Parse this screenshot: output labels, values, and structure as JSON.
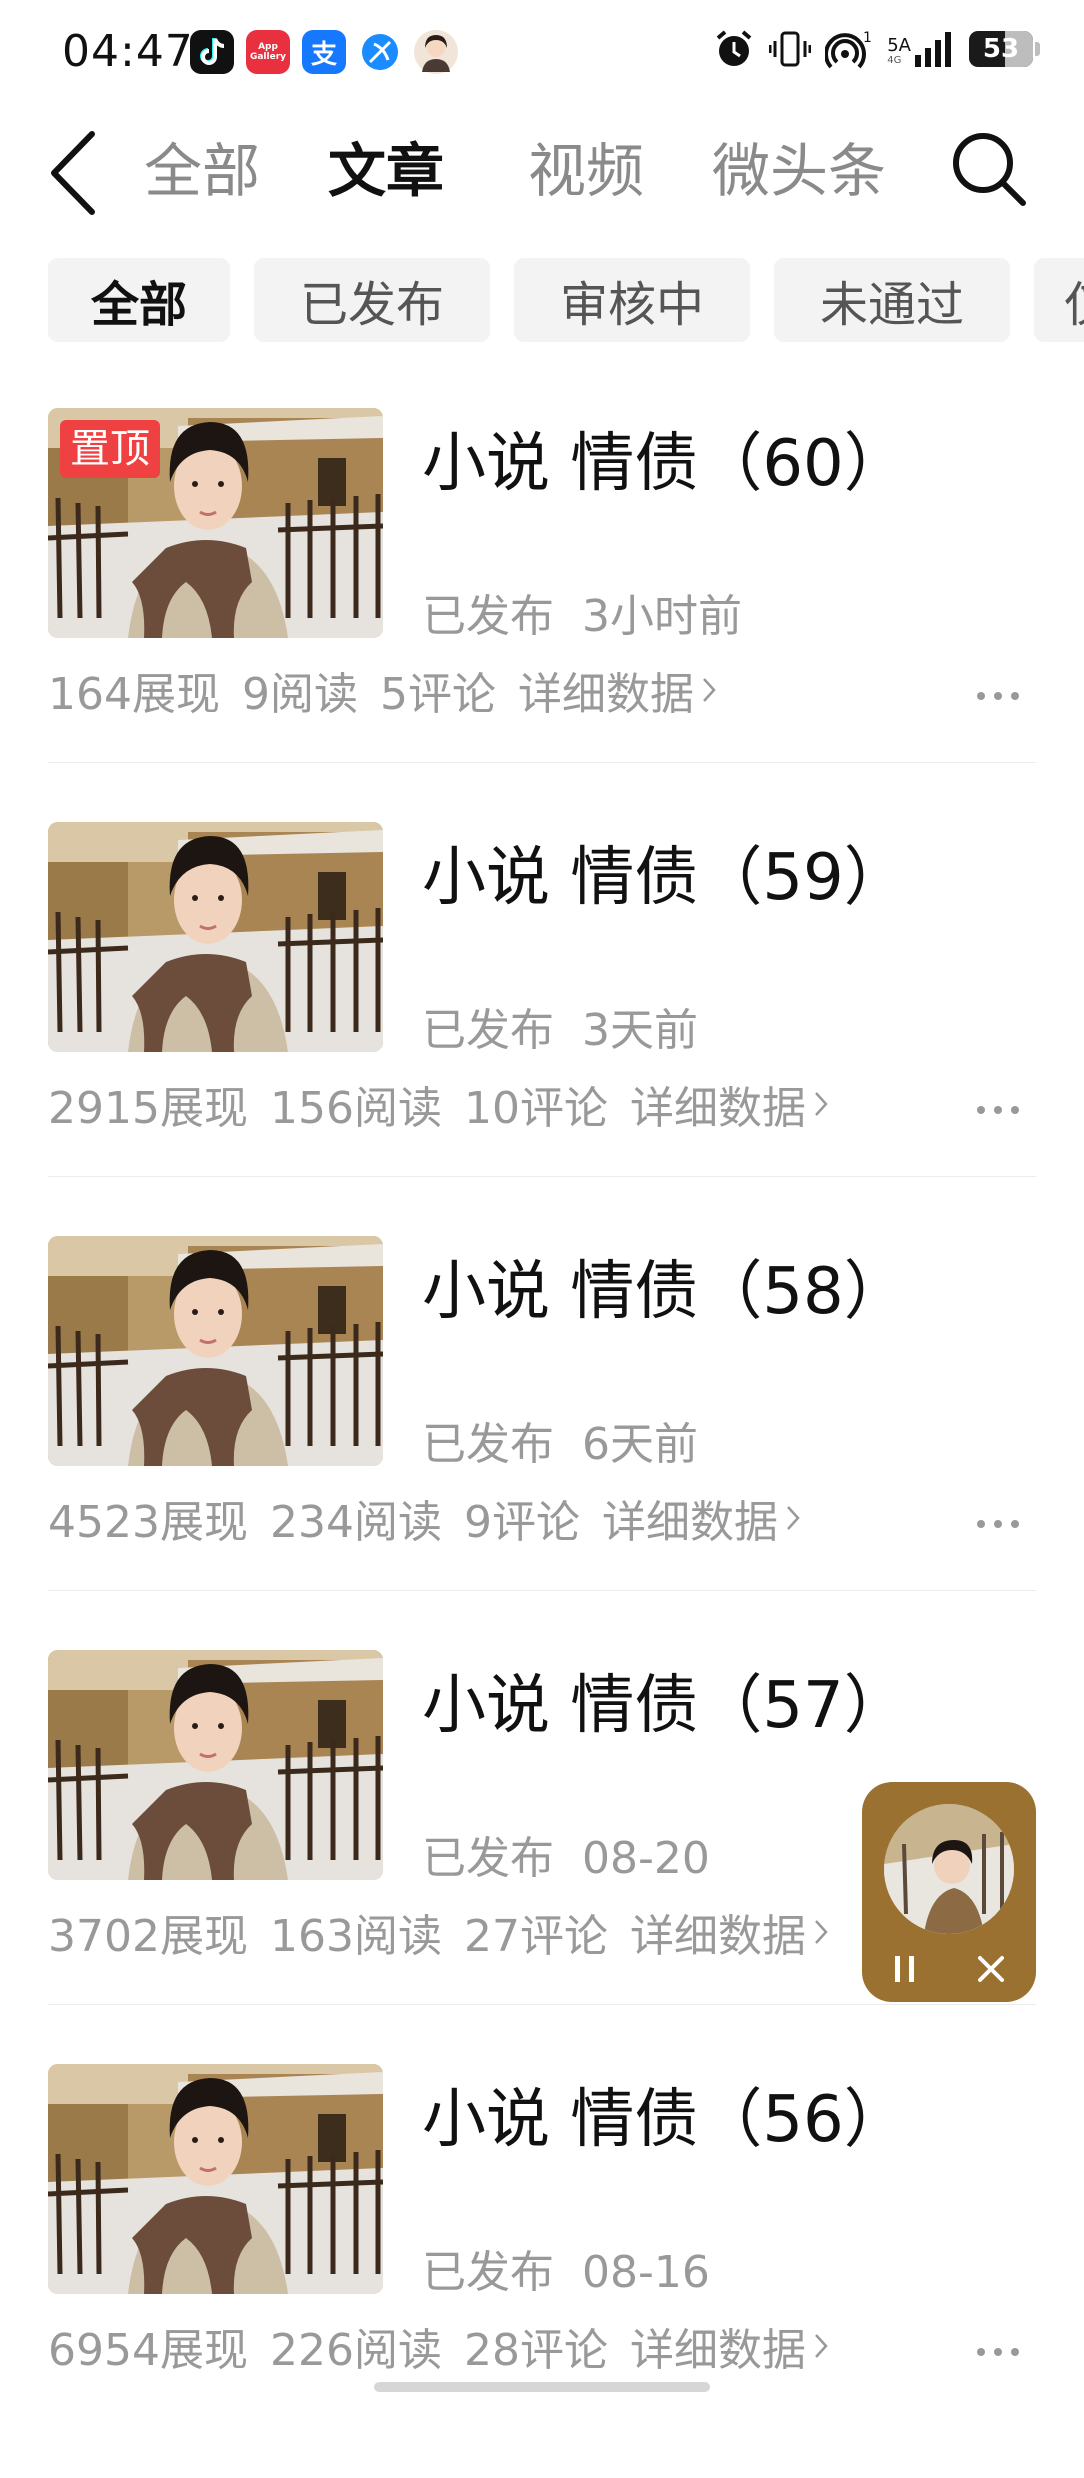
{
  "status_bar": {
    "time": "04:47",
    "apps": [
      "tiktok-icon",
      "app-gallery-icon",
      "alipay-icon",
      "browser-icon",
      "avatar-icon"
    ],
    "app_gallery_label": "App Gallery",
    "alipay_glyph": "支",
    "network_label": "5A",
    "hotspot_count": "1",
    "battery": "53"
  },
  "nav": {
    "tabs": [
      "全部",
      "文章",
      "视频",
      "微头条"
    ],
    "active_tab": "文章"
  },
  "filters": {
    "chips": [
      "全部",
      "已发布",
      "审核中",
      "未通过",
      "仅"
    ],
    "active": "全部"
  },
  "articles": [
    {
      "title": "小说 情债（60）",
      "pinned": true,
      "pin_label": "置顶",
      "status": "已发布",
      "time": "3小时前",
      "views": "164展现",
      "reads": "9阅读",
      "comments": "5评论",
      "detail": "详细数据"
    },
    {
      "title": "小说 情债（59）",
      "pinned": false,
      "status": "已发布",
      "time": "3天前",
      "views": "2915展现",
      "reads": "156阅读",
      "comments": "10评论",
      "detail": "详细数据"
    },
    {
      "title": "小说 情债（58）",
      "pinned": false,
      "status": "已发布",
      "time": "6天前",
      "views": "4523展现",
      "reads": "234阅读",
      "comments": "9评论",
      "detail": "详细数据"
    },
    {
      "title": "小说 情债（57）",
      "pinned": false,
      "status": "已发布",
      "time": "08-20",
      "views": "3702展现",
      "reads": "163阅读",
      "comments": "27评论",
      "detail": "详细数据"
    },
    {
      "title": "小说 情债（56）",
      "pinned": false,
      "status": "已发布",
      "time": "08-16",
      "views": "6954展现",
      "reads": "226阅读",
      "comments": "28评论",
      "detail": "详细数据"
    }
  ],
  "mini_player": {
    "pause_icon": "pause-icon",
    "close_icon": "close-icon"
  },
  "colors": {
    "pin_badge": "#f04142",
    "mini_player_bg": "#9a7131",
    "muted_text": "#999999",
    "chip_bg": "#f3f3f3"
  }
}
